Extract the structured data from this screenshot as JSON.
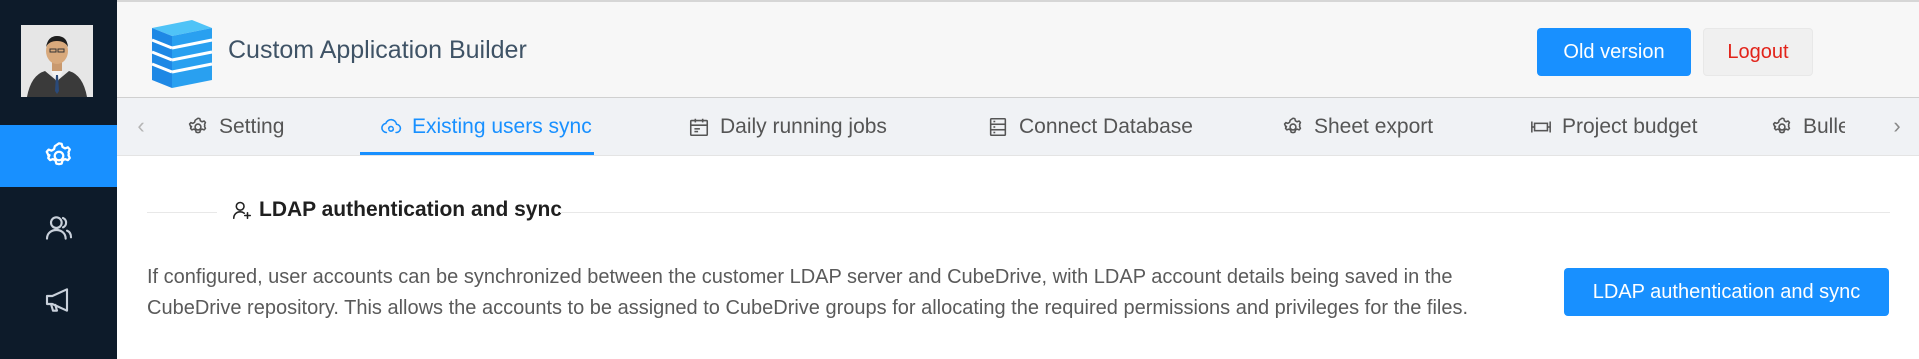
{
  "header": {
    "title": "Custom Application Builder",
    "old_version_label": "Old version",
    "logout_label": "Logout"
  },
  "sidebar": {
    "items": [
      {
        "icon": "gear-icon",
        "active": true
      },
      {
        "icon": "users-icon",
        "active": false
      },
      {
        "icon": "megaphone-icon",
        "active": false
      }
    ]
  },
  "tabs": [
    {
      "label": "Setting",
      "icon": "gear-icon",
      "active": false
    },
    {
      "label": "Existing users sync",
      "icon": "cloud-sync-icon",
      "active": true
    },
    {
      "label": "Daily running jobs",
      "icon": "calendar-icon",
      "active": false
    },
    {
      "label": "Connect Database",
      "icon": "database-icon",
      "active": false
    },
    {
      "label": "Sheet export",
      "icon": "gear-icon",
      "active": false
    },
    {
      "label": "Project budget",
      "icon": "budget-icon",
      "active": false
    },
    {
      "label": "Bulle",
      "icon": "gear-icon",
      "active": false
    }
  ],
  "section": {
    "title": "LDAP authentication and sync",
    "description": "If configured, user accounts can be synchronized between the customer LDAP server and CubeDrive, with LDAP account details being saved in the CubeDrive repository. This allows the accounts to be assigned to CubeDrive groups for allocating the required permissions and privileges for the files.",
    "button_label": "LDAP authentication and sync"
  },
  "colors": {
    "accent": "#1890ff",
    "sidebar_bg": "#0d1b2a",
    "logout_text": "#e2231a"
  }
}
